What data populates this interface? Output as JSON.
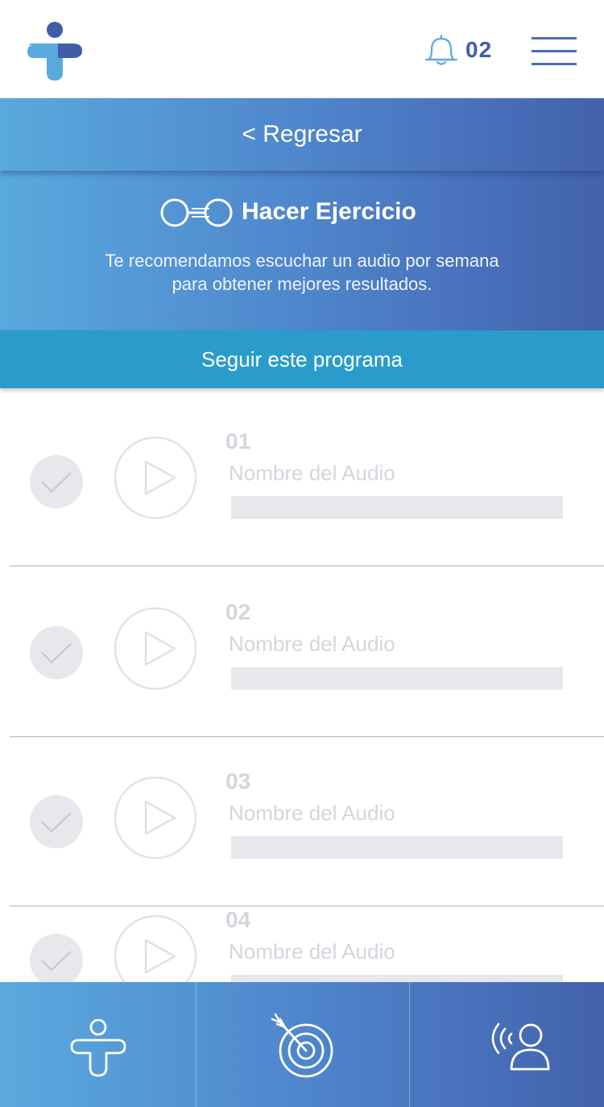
{
  "header": {
    "logo_icon": "app-logo",
    "notification_icon": "bell-icon",
    "notification_count": "02",
    "menu_icon": "hamburger-menu-icon"
  },
  "back": {
    "label": "< Regresar"
  },
  "exercise": {
    "icon": "exercise-path-icon",
    "title": "Hacer Ejercicio",
    "description_line1": "Te recomendamos escuchar un audio por semana",
    "description_line2": "para obtener mejores resultados."
  },
  "follow_program": {
    "label": "Seguir este programa"
  },
  "audios": [
    {
      "number": "01",
      "name": "Nombre del Audio",
      "progress": 0
    },
    {
      "number": "02",
      "name": "Nombre del Audio",
      "progress": 0
    },
    {
      "number": "03",
      "name": "Nombre del Audio",
      "progress": 0
    },
    {
      "number": "04",
      "name": "Nombre del Audio",
      "progress": 0
    }
  ],
  "bottom_nav": [
    {
      "icon": "person-logo-icon"
    },
    {
      "icon": "target-icon"
    },
    {
      "icon": "voice-profile-icon"
    }
  ],
  "colors": {
    "brand_blue": "#4361ad",
    "light_blue": "#59a9de",
    "accent_cyan": "#2a9ccc",
    "disabled_gray": "#d3d6dd"
  }
}
